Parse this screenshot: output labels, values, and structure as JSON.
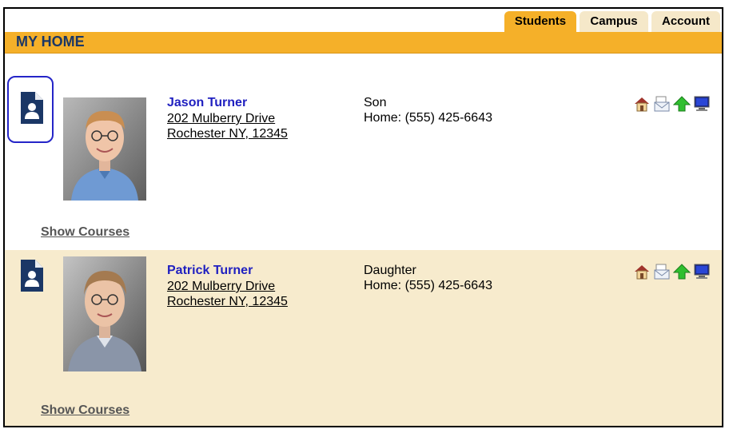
{
  "tabs": [
    {
      "label": "Students",
      "active": true
    },
    {
      "label": "Campus",
      "active": false
    },
    {
      "label": "Account",
      "active": false
    }
  ],
  "header": {
    "title": "MY HOME"
  },
  "students": [
    {
      "name": "Jason Turner",
      "address_line1": "202 Mulberry Drive",
      "address_line2": "Rochester NY, 12345",
      "relationship": "Son",
      "phone": "Home: (555) 425-6643",
      "show_courses_label": "Show Courses"
    },
    {
      "name": "Patrick Turner",
      "address_line1": "202 Mulberry Drive",
      "address_line2": "Rochester NY, 12345",
      "relationship": "Daughter",
      "phone": "Home: (555) 425-6643",
      "show_courses_label": "Show Courses"
    }
  ],
  "icons": [
    "home-icon",
    "mail-icon",
    "up-arrow-icon",
    "computer-icon"
  ],
  "colors": {
    "accent": "#f5b029",
    "tab_inactive": "#f5e8c9",
    "row_alt": "#f7ebcd",
    "link_blue": "#2020c0",
    "title_navy": "#1b3766",
    "id_card_navy": "#1b3766",
    "focus_ring": "#2525c8"
  }
}
